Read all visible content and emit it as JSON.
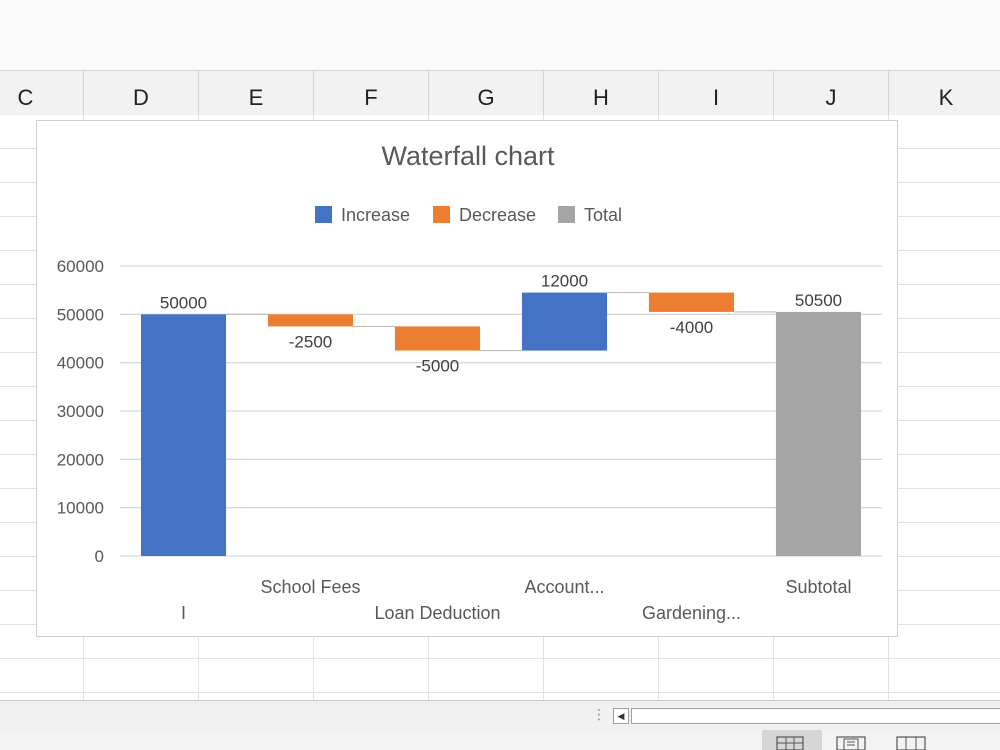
{
  "columns": [
    "C",
    "D",
    "E",
    "F",
    "G",
    "H",
    "I",
    "J",
    "K"
  ],
  "chart": {
    "title": "Waterfall chart",
    "legend": [
      {
        "label": "Increase",
        "color": "#4472c4"
      },
      {
        "label": "Decrease",
        "color": "#ed7d31"
      },
      {
        "label": "Total",
        "color": "#a5a5a5"
      }
    ]
  },
  "chart_data": {
    "type": "bar",
    "subtype": "waterfall",
    "title": "Waterfall chart",
    "categories": [
      "I",
      "School Fees",
      "Loan Deduction",
      "Account...",
      "Gardening...",
      "Subtotal"
    ],
    "values": [
      50000,
      -2500,
      -5000,
      12000,
      -4000,
      50500
    ],
    "data_labels": [
      "50000",
      "-2500",
      "-5000",
      "12000",
      "-4000",
      "50500"
    ],
    "kinds": [
      "increase",
      "decrease",
      "decrease",
      "increase",
      "decrease",
      "total"
    ],
    "ylim": [
      0,
      60000
    ],
    "yticks": [
      "0",
      "10000",
      "20000",
      "30000",
      "40000",
      "50000",
      "60000"
    ],
    "grid": true,
    "legend_position": "top",
    "colors": {
      "increase": "#4472c4",
      "decrease": "#ed7d31",
      "total": "#a5a5a5"
    }
  },
  "view_buttons": [
    {
      "name": "normal-view-button",
      "icon": "grid-icon",
      "active": true
    },
    {
      "name": "page-layout-view-button",
      "icon": "page-icon",
      "active": false
    },
    {
      "name": "page-break-view-button",
      "icon": "columns-icon",
      "active": false
    }
  ]
}
